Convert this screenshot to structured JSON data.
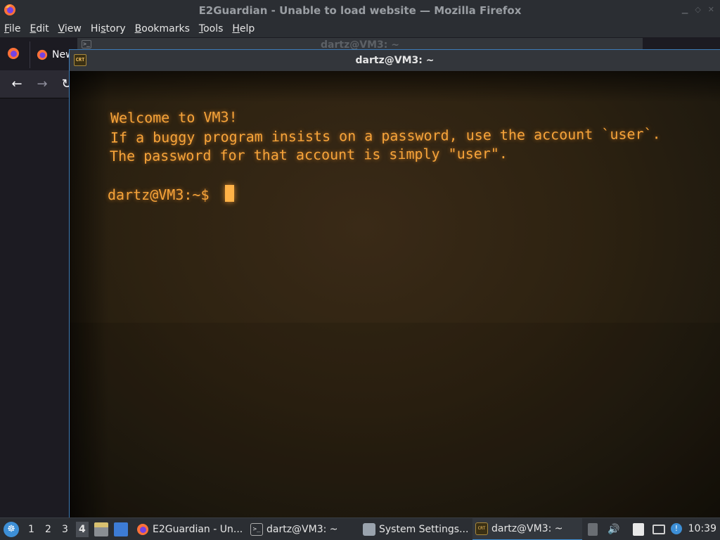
{
  "firefox": {
    "window_title": "E2Guardian - Unable to load website — Mozilla Firefox",
    "menu": [
      "File",
      "Edit",
      "View",
      "History",
      "Bookmarks",
      "Tools",
      "Help"
    ],
    "menu_mnemonics": [
      "F",
      "E",
      "V",
      "s",
      "B",
      "T",
      "H"
    ],
    "tab_new_label": "New",
    "nav": {
      "back_icon": "arrow-left-icon",
      "forward_icon": "arrow-right-icon",
      "reload_icon": "reload-icon"
    }
  },
  "terminal_background": {
    "title": "dartz@VM3: ~"
  },
  "crt_terminal": {
    "title": "dartz@VM3: ~",
    "icon_text": "CRT",
    "lines": [
      "Welcome to VM3!",
      "If a buggy program insists on a password, use the account `user`.",
      "The password for that account is simply \"user\"."
    ],
    "prompt": "dartz@VM3:~$ ",
    "text_color": "#f7a43a"
  },
  "taskbar": {
    "workspaces": [
      "1",
      "2",
      "3",
      "4"
    ],
    "active_workspace": "4",
    "tasks": [
      {
        "label": "E2Guardian - Un...",
        "icon": "firefox-icon"
      },
      {
        "label": "dartz@VM3: ~",
        "icon": "terminal-icon"
      },
      {
        "label": "System Settings...",
        "icon": "settings-icon"
      },
      {
        "label": "dartz@VM3: ~",
        "icon": "crt-icon"
      }
    ],
    "clock": "10:39"
  }
}
